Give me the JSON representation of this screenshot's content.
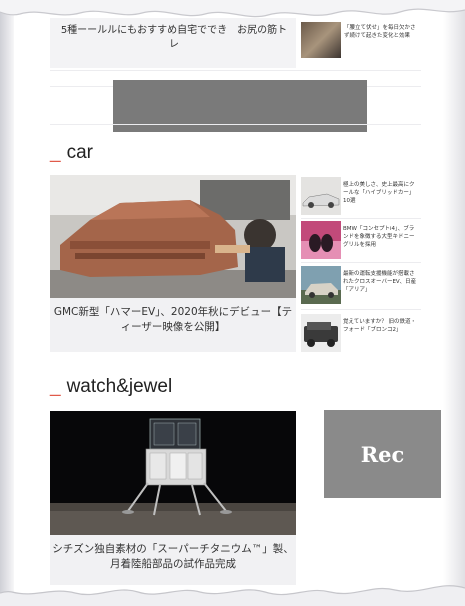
{
  "top_card": {
    "caption": "5種ーールルにもおすすめ自宅ででき　お尻の筋トレ",
    "side_text": "「腰立て伏せ」を毎日欠かさず続けて起きた変化と効果"
  },
  "sections": [
    {
      "title": "car",
      "feature": {
        "caption": "GMC新型「ハマーEV」、2020年秋にデビュー【ティーザー映像を公開】"
      },
      "side_items": [
        {
          "text": "極上の美しさ、史上最高にクールな「ハイブリッドカー」10選"
        },
        {
          "text": "BMW「コンセプトi4」、ブランドを象徴する大型キドニーグリルを採用"
        },
        {
          "text": "最新の運転支援機能が搭載されたクロスオーバーEV、日産「アリア」"
        },
        {
          "text": "覚えていますか？ 旧の鉄道・フォード「ブロンコ2」"
        }
      ]
    },
    {
      "title": "watch&jewel",
      "feature": {
        "caption": "シチズン独自素材の「スーパーチタニウム™」製、月着陸船部品の試作品完成"
      }
    }
  ],
  "ad": {
    "label": "Rec"
  },
  "colors": {
    "accent": "#e05a4a",
    "placeholder": "#7a7a7a",
    "ad_box": "#8a8a8a"
  }
}
